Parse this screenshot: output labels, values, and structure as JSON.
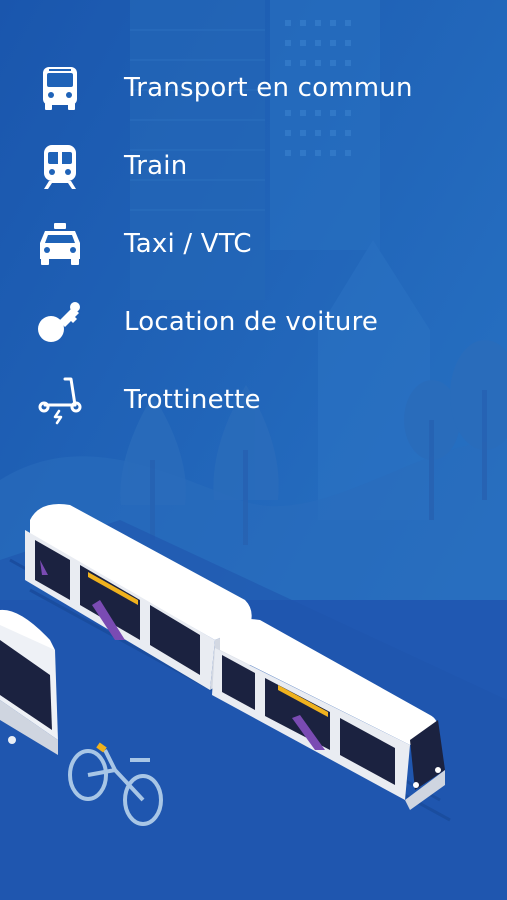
{
  "modes": [
    {
      "label": "Transport en commun",
      "icon": "bus-icon"
    },
    {
      "label": "Train",
      "icon": "train-icon"
    },
    {
      "label": "Taxi / VTC",
      "icon": "taxi-icon"
    },
    {
      "label": "Location de voiture",
      "icon": "car-key-icon"
    },
    {
      "label": "Trottinette",
      "icon": "electric-scooter-icon"
    }
  ],
  "colors": {
    "background": "#1f63b8",
    "text": "#ffffff",
    "tram_body": "#f2f3f7",
    "tram_accent": "#f0b21e"
  }
}
